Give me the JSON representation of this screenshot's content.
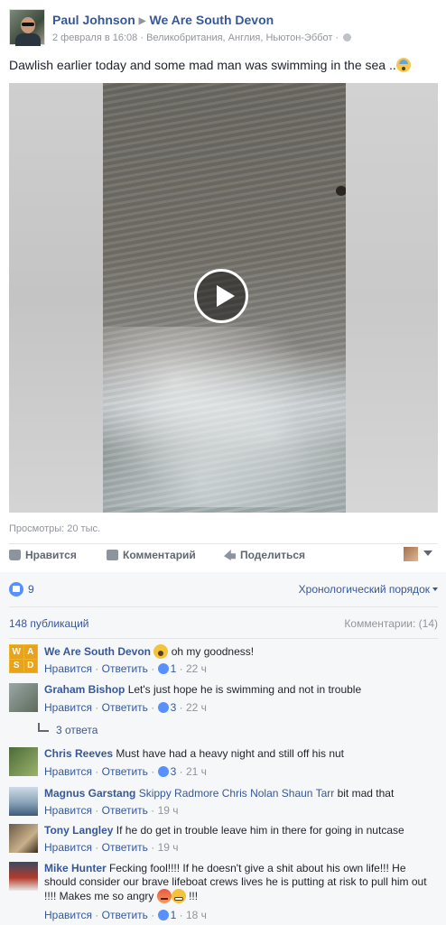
{
  "post": {
    "author": "Paul Johnson",
    "group": "We Are South Devon",
    "date": "2 февраля в 16:08",
    "location": "Великобритания, Англия, Ньютон-Эббот",
    "meta_sep": "·",
    "text": "Dawlish earlier today and some mad man was swimming in the sea ..",
    "views": "Просмотры: 20 тыс."
  },
  "actions": {
    "like": "Нравится",
    "comment": "Комментарий",
    "share": "Поделиться"
  },
  "reactions": {
    "count": "9",
    "order": "Хронологический порядок"
  },
  "summary": {
    "publications": "148 публикаций",
    "comments": "Комментарии: (14)"
  },
  "comment_actions": {
    "like": "Нравится",
    "reply": "Ответить",
    "sep": "·"
  },
  "comments": [
    {
      "name": "We Are South Devon",
      "text": "oh my goodness!",
      "likes": "1",
      "time": "22 ч"
    },
    {
      "name": "Graham Bishop",
      "text": "Let's just hope he is swimming and not in trouble",
      "likes": "3",
      "time": "22 ч",
      "replies": "3 ответа"
    },
    {
      "name": "Chris Reeves",
      "text": "Must have had a heavy night and still off his nut",
      "likes": "3",
      "time": "21 ч"
    },
    {
      "name": "Magnus Garstang",
      "tags": "Skippy Radmore Chris Nolan Shaun Tarr",
      "text": "bit mad that",
      "time": "19 ч"
    },
    {
      "name": "Tony Langley",
      "text": "If he do get in trouble leave him in there for going in nutcase",
      "time": "19 ч"
    },
    {
      "name": "Mike Hunter",
      "text": "Fecking fool!!!! If he doesn't give a shit about his own life!!! He should consider our brave lifeboat crews lives he is putting at risk to pull him out !!!! Makes me so angry",
      "text_end": "!!!",
      "likes": "1",
      "time": "18 ч"
    }
  ],
  "avatar_letters": [
    "W",
    "A",
    "S",
    "D"
  ]
}
